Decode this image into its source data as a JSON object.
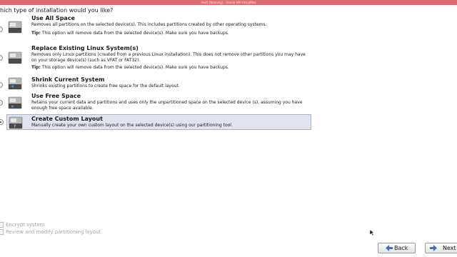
{
  "window": {
    "title": "rhel5 [Running] - Oracle VM VirtualBox"
  },
  "question": "hich type of installation would you like?",
  "options": [
    {
      "title": "Use All Space",
      "description": "Removes all partitions on the selected device(s).  This includes partitions created by other operating systems.",
      "tip_label": "Tip:",
      "tip_text": "This option will remove data from the selected device(s).  Make sure you have backups.",
      "selected": false,
      "icon": "hard-disk-icon"
    },
    {
      "title": "Replace Existing Linux System(s)",
      "description": "Removes only Linux partitions (created from a previous Linux installation).  This does not remove other partitions you may have on your storage device(s) (such as VFAT or FAT32).",
      "tip_label": "Tip:",
      "tip_text": "This option will remove data from the selected device(s).  Make sure you have backups.",
      "selected": false,
      "icon": "hard-disk-icon"
    },
    {
      "title": "Shrink Current System",
      "description": "Shrinks existing partitions to create free space for the default layout.",
      "selected": false,
      "icon": "hard-disk-shrink-icon"
    },
    {
      "title": "Use Free Space",
      "description": "Retains your current data and partitions and uses only the unpartitioned space on the selected device (s), assuming you have enough free space available.",
      "selected": false,
      "icon": "hard-disk-free-icon"
    },
    {
      "title": "Create Custom Layout",
      "description": "Manually create your own custom layout on the selected device(s) using our partitioning tool.",
      "selected": true,
      "icon": "hard-disk-custom-icon",
      "icon_glyph": "?"
    }
  ],
  "checkboxes": [
    {
      "label": "Encrypt system",
      "checked": false,
      "enabled": false
    },
    {
      "label": "Review and modify partitioning layout",
      "checked": false,
      "enabled": false
    }
  ],
  "buttons": {
    "back": "Back",
    "next": "Next"
  },
  "colors": {
    "titlebar": "#e06b6e",
    "selection": "#dfe4ee",
    "disabled_text": "#a3a3a3"
  }
}
